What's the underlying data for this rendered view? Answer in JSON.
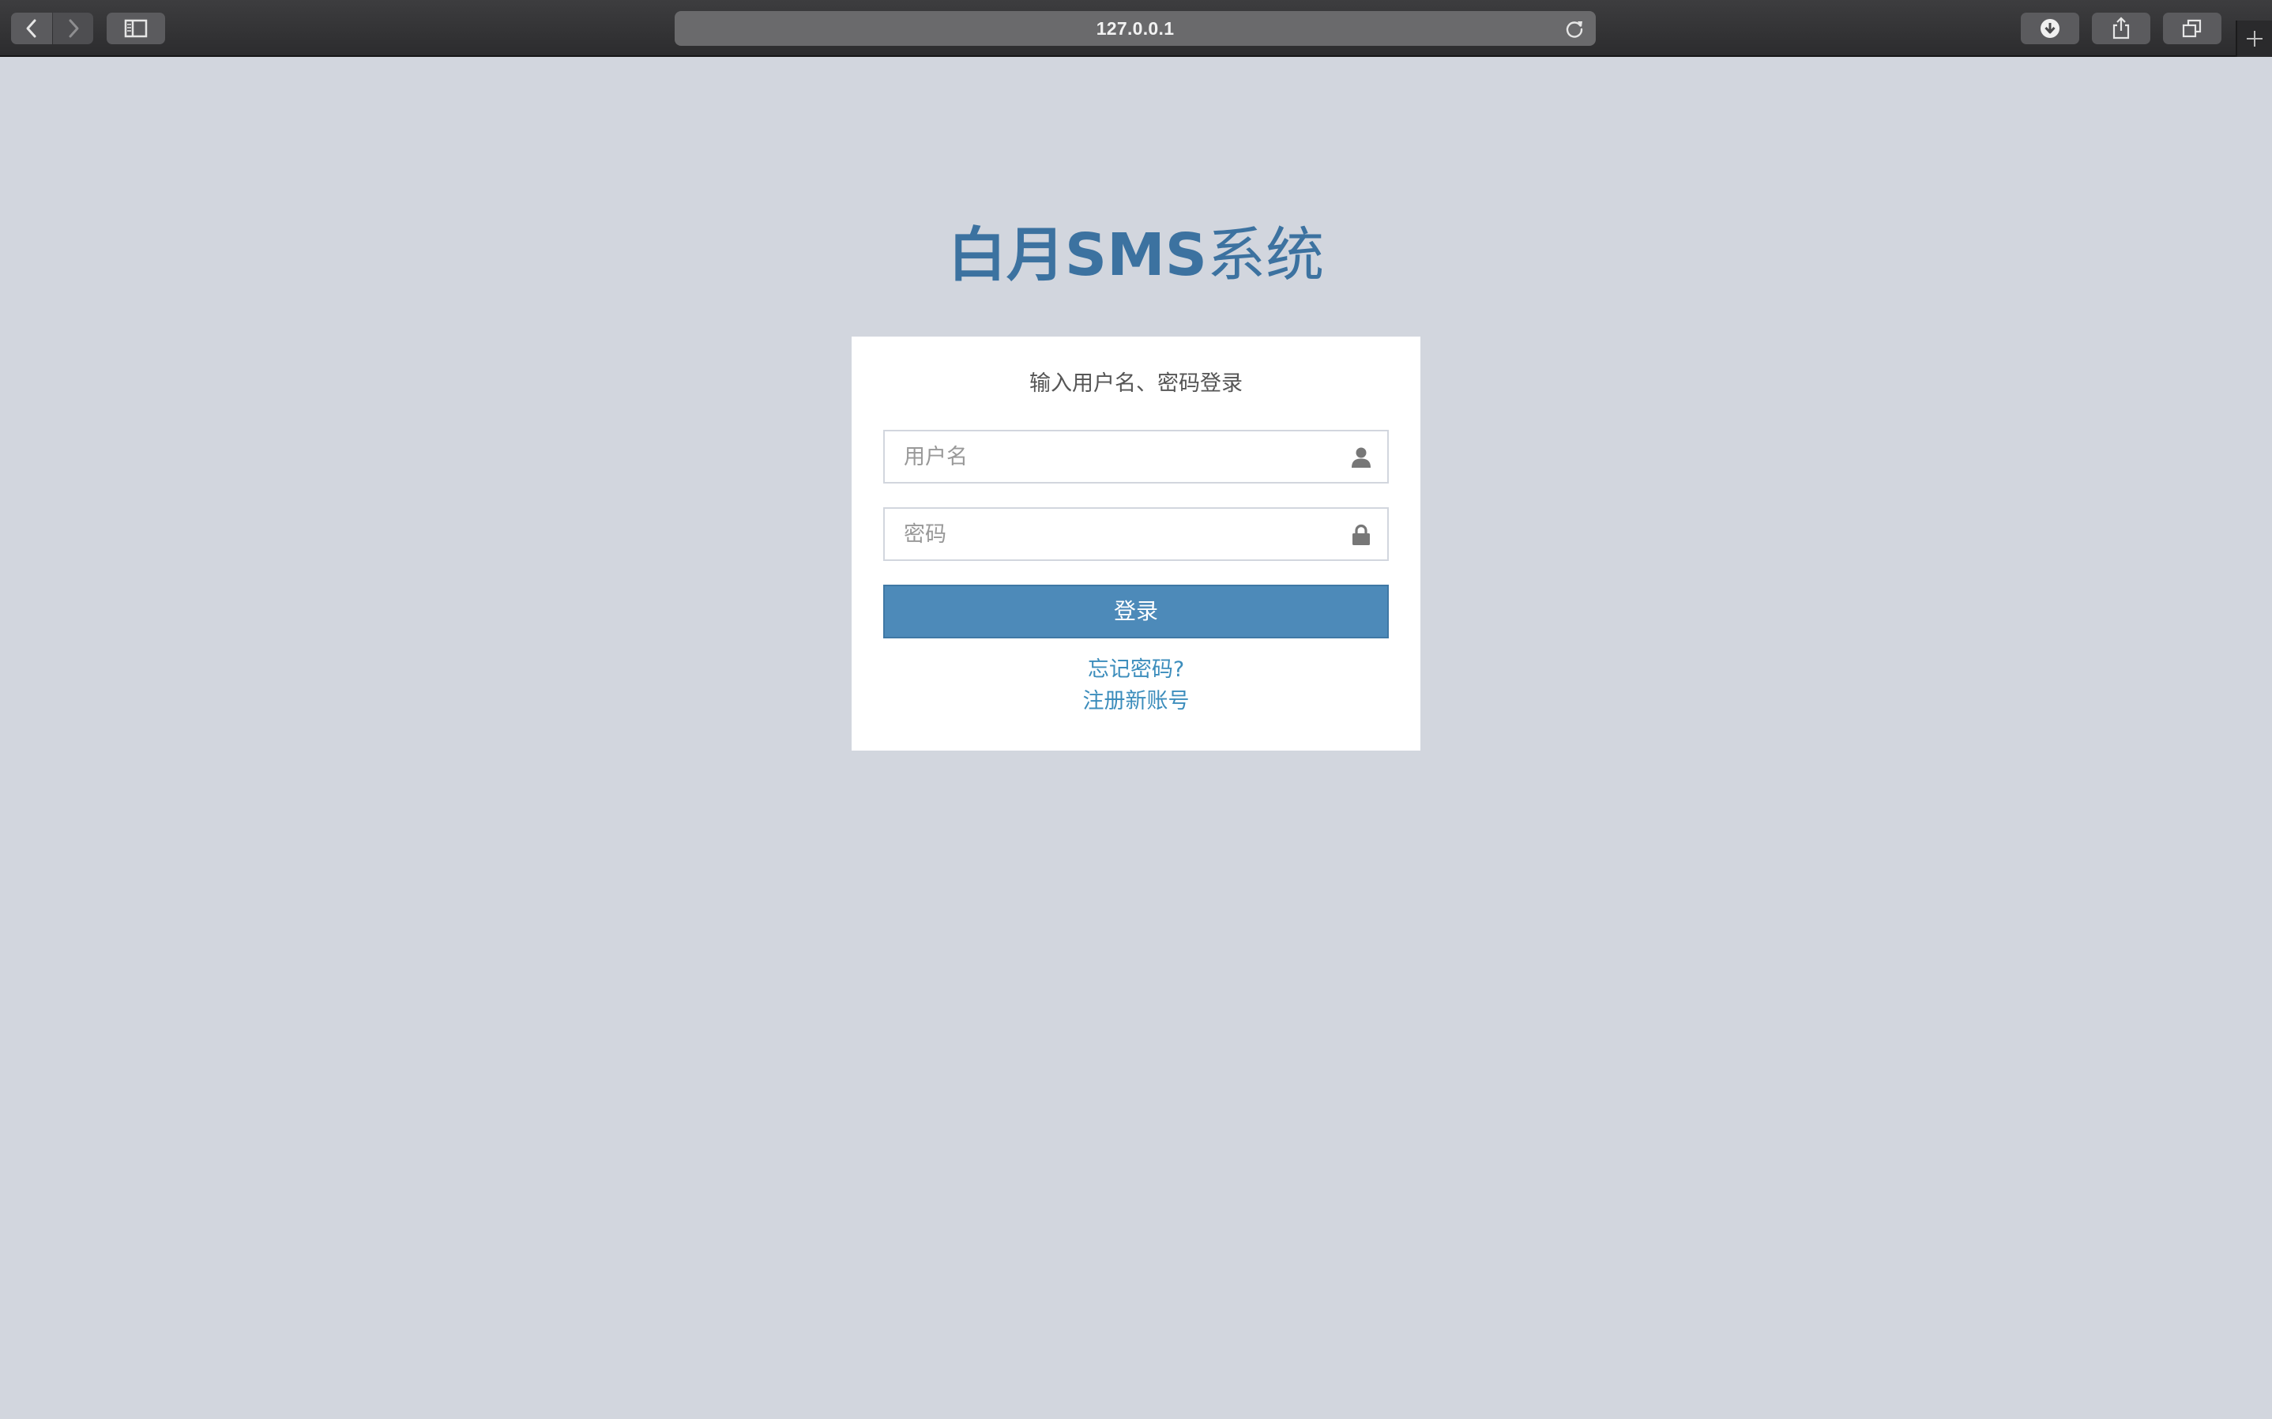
{
  "browser": {
    "url": "127.0.0.1",
    "icons": {
      "back": "chevron-left-icon",
      "forward": "chevron-right-icon",
      "sidebar": "sidebar-icon",
      "reload": "reload-icon",
      "download": "download-icon",
      "share": "share-icon",
      "tabs": "tabs-icon",
      "new_tab": "plus-icon"
    }
  },
  "page": {
    "logo": {
      "part1": "白月SMS",
      "part2": "系统"
    },
    "login_message": "输入用户名、密码登录",
    "username": {
      "placeholder": "用户名",
      "value": "",
      "icon": "user-icon"
    },
    "password": {
      "placeholder": "密码",
      "value": "",
      "icon": "lock-icon"
    },
    "login_button": "登录",
    "forgot_password": "忘记密码?",
    "register": "注册新账号",
    "colors": {
      "background": "#d2d6de",
      "brand": "#3c72a0",
      "button": "#4d8ab9",
      "link": "#3c8dbc"
    }
  }
}
